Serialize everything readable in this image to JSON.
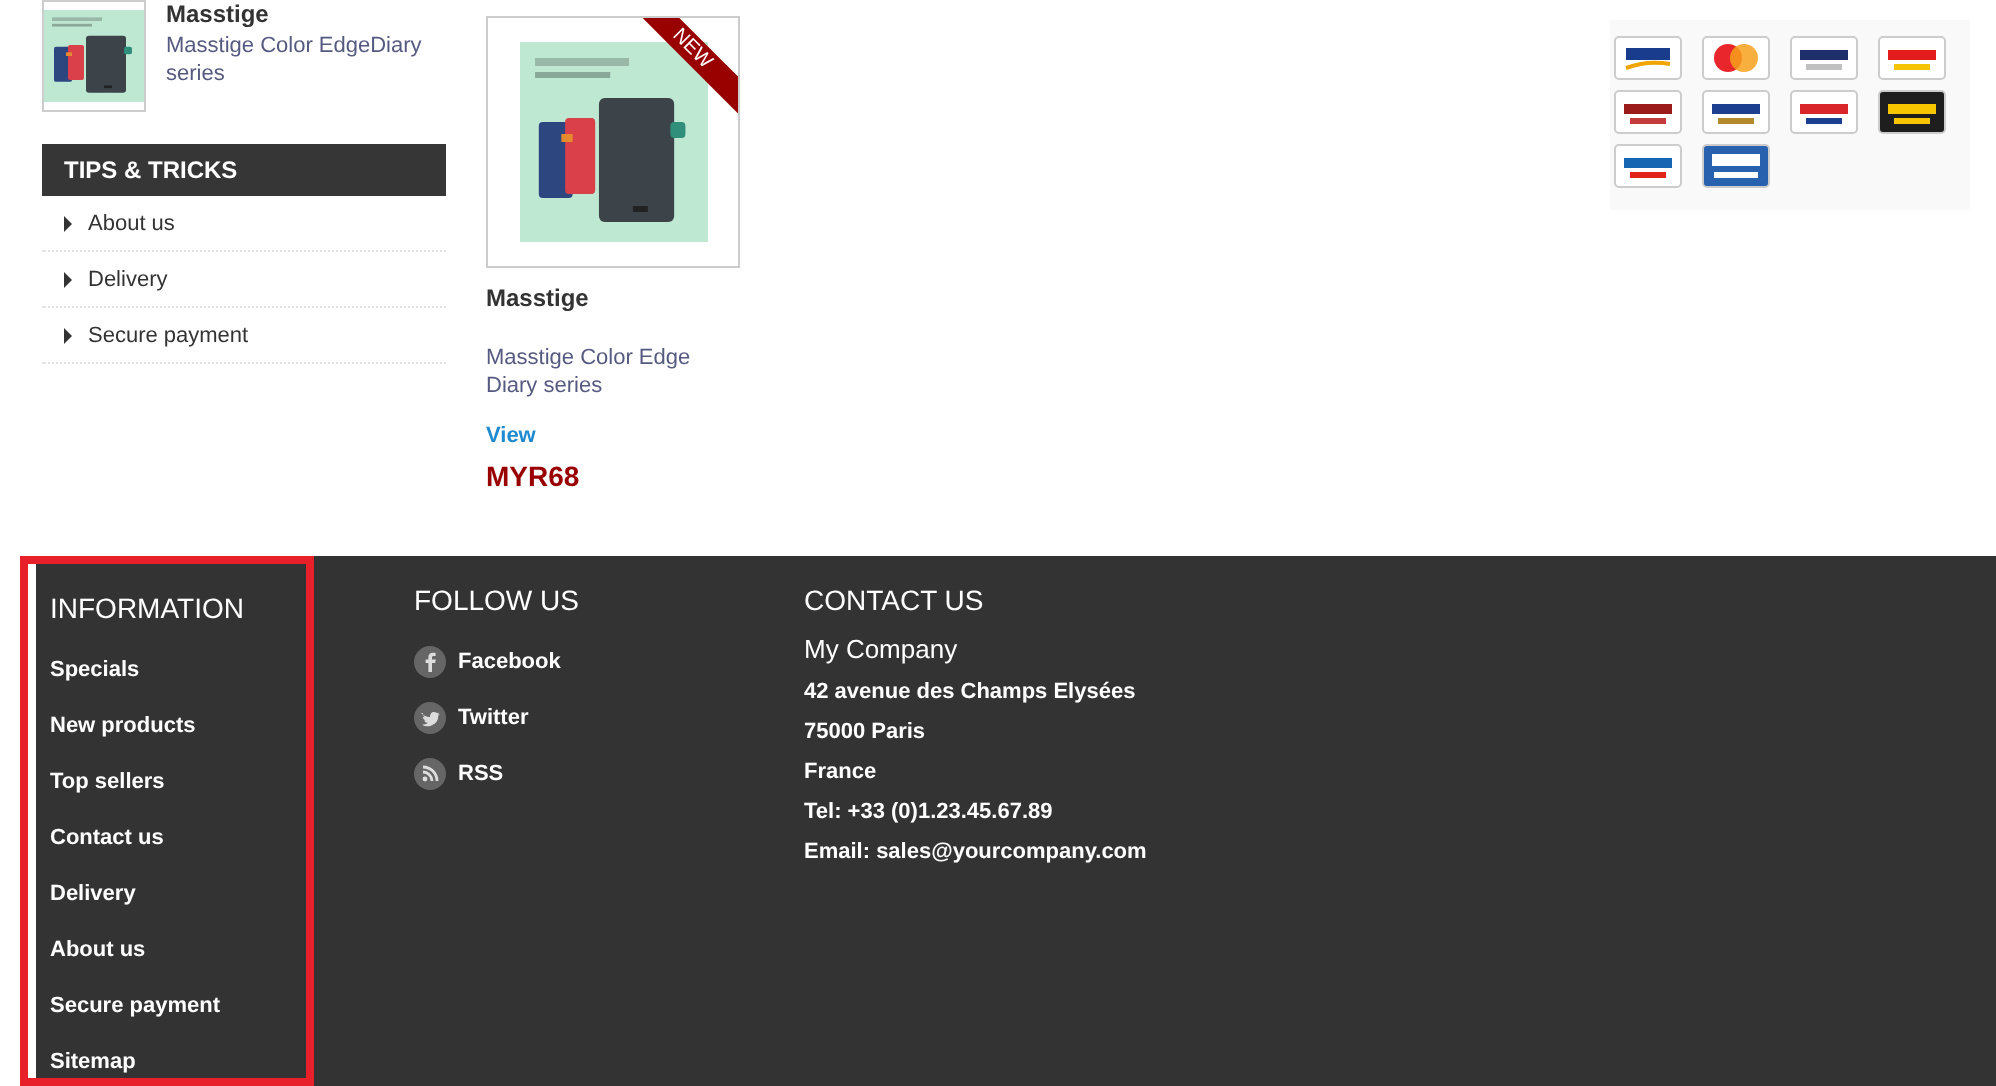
{
  "side_product": {
    "title": "Masstige",
    "description": "Masstige Color EdgeDiary series"
  },
  "tips": {
    "heading": "TIPS & TRICKS",
    "items": [
      "About us",
      "Delivery",
      "Secure payment"
    ]
  },
  "product": {
    "badge": "NEW",
    "name": "Masstige",
    "description": "Masstige Color Edge Diary series",
    "link": "View",
    "price": "MYR68"
  },
  "payment_methods": [
    {
      "kind": "visa"
    },
    {
      "kind": "mastercard"
    },
    {
      "kind": "alliance"
    },
    {
      "kind": "ambank"
    },
    {
      "kind": "cimb"
    },
    {
      "kind": "fpx"
    },
    {
      "kind": "hongleong"
    },
    {
      "kind": "maybank"
    },
    {
      "kind": "rhb"
    },
    {
      "kind": "cod"
    }
  ],
  "footer": {
    "information": {
      "heading": "INFORMATION",
      "links": [
        "Specials",
        "New products",
        "Top sellers",
        "Contact us",
        "Delivery",
        "About us",
        "Secure payment",
        "Sitemap"
      ]
    },
    "follow": {
      "heading": "FOLLOW US",
      "links": [
        {
          "kind": "facebook",
          "label": "Facebook"
        },
        {
          "kind": "twitter",
          "label": "Twitter"
        },
        {
          "kind": "rss",
          "label": "RSS"
        }
      ]
    },
    "contact": {
      "heading": "CONTACT US",
      "company": "My Company",
      "lines": [
        "42 avenue des Champs Elysées",
        "75000 Paris",
        "France",
        "Tel: +33 (0)1.23.45.67.89",
        "Email: sales@yourcompany.com"
      ]
    }
  }
}
